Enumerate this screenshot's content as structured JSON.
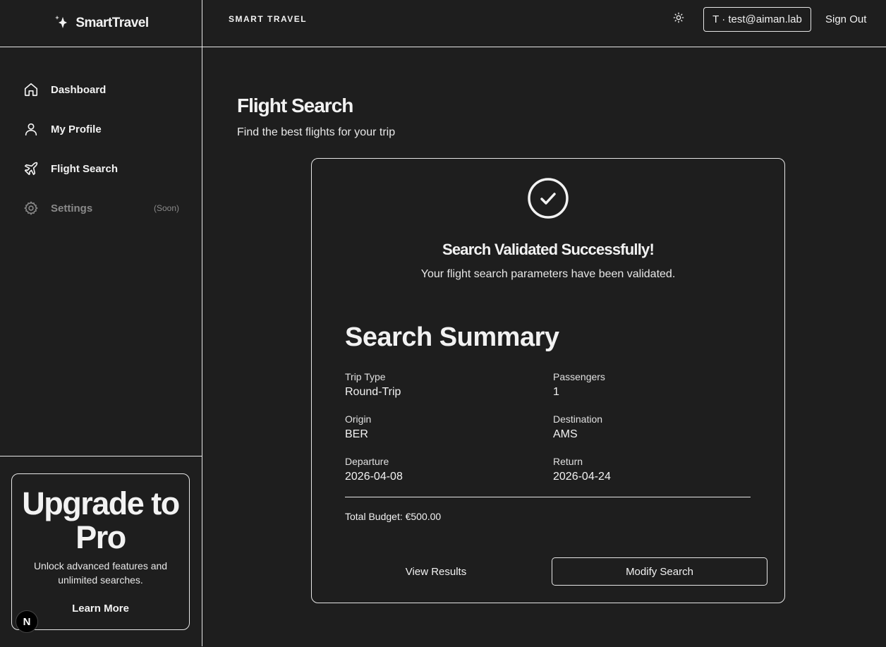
{
  "brand": {
    "name": "SmartTravel",
    "logo_icon": "sparkle-icon"
  },
  "sidebar": {
    "items": [
      {
        "label": "Dashboard",
        "icon": "home-icon"
      },
      {
        "label": "My Profile",
        "icon": "user-icon"
      },
      {
        "label": "Flight Search",
        "icon": "plane-icon"
      },
      {
        "label": "Settings",
        "icon": "gear-icon",
        "badge": "(Soon)",
        "disabled": true
      }
    ],
    "upgrade": {
      "title": "Upgrade to Pro",
      "text": "Unlock advanced features and unlimited searches.",
      "cta": "Learn More"
    },
    "dev_badge": "N"
  },
  "topbar": {
    "title": "SMART TRAVEL",
    "theme_icon": "sun-icon",
    "user": "T · test@aiman.lab",
    "signout": "Sign Out"
  },
  "page": {
    "title": "Flight Search",
    "subtitle": "Find the best flights for your trip"
  },
  "result": {
    "status_icon": "check-circle-icon",
    "title": "Search Validated Successfully!",
    "subtitle": "Your flight search parameters have been validated.",
    "summary_title": "Search Summary",
    "fields": {
      "trip_type": {
        "label": "Trip Type",
        "value": "Round-Trip"
      },
      "passengers": {
        "label": "Passengers",
        "value": "1"
      },
      "origin": {
        "label": "Origin",
        "value": "BER"
      },
      "destination": {
        "label": "Destination",
        "value": "AMS"
      },
      "departure": {
        "label": "Departure",
        "value": "2026-04-08"
      },
      "return": {
        "label": "Return",
        "value": "2026-04-24"
      }
    },
    "budget": "Total Budget: €500.00",
    "view_results": "View Results",
    "modify_search": "Modify Search"
  },
  "colors": {
    "background": "#1e1e1e",
    "text": "#f2f2f2",
    "border": "#e6e6e6",
    "muted": "#8a8a8a"
  }
}
